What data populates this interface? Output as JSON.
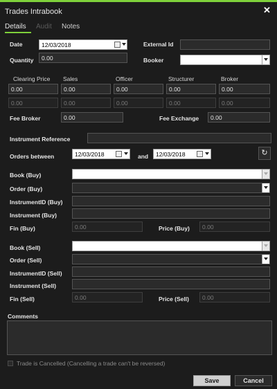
{
  "window": {
    "title": "Trades Intrabook",
    "close_glyph": "✕"
  },
  "tabs": [
    {
      "label": "Details",
      "state": "active"
    },
    {
      "label": "Audit",
      "state": "disabled"
    },
    {
      "label": "Notes",
      "state": "normal"
    }
  ],
  "header_fields": {
    "date_label": "Date",
    "date_value": "12/03/2018",
    "external_id_label": "External Id",
    "external_id_value": "",
    "quantity_label": "Quantity",
    "quantity_value": "0.00",
    "booker_label": "Booker",
    "booker_value": ""
  },
  "fees_grid": {
    "headers": [
      "Clearing Price",
      "Sales",
      "Officer",
      "Structurer",
      "Broker"
    ],
    "row1": [
      "0.00",
      "0.00",
      "0.00",
      "0.00",
      "0.00"
    ],
    "row2": [
      "0.00",
      "0.00",
      "0.00",
      "0.00",
      "0.00"
    ]
  },
  "fee_broker": {
    "label": "Fee Broker",
    "value": "0.00"
  },
  "fee_exchange": {
    "label": "Fee Exchange",
    "value": "0.00"
  },
  "instrument_reference": {
    "label": "Instrument Reference",
    "value": ""
  },
  "orders_between": {
    "label": "Orders between",
    "from": "12/03/2018",
    "and_label": "and",
    "to": "12/03/2018"
  },
  "buy": {
    "book_label": "Book (Buy)",
    "book_value": "",
    "order_label": "Order (Buy)",
    "order_value": "",
    "instrument_id_label": "InstrumentID (Buy)",
    "instrument_id_value": "",
    "instrument_label": "Instrument (Buy)",
    "instrument_value": "",
    "fin_label": "Fin (Buy)",
    "fin_value": "0.00",
    "price_label": "Price (Buy)",
    "price_value": "0.00"
  },
  "sell": {
    "book_label": "Book (Sell)",
    "book_value": "",
    "order_label": "Order (Sell)",
    "order_value": "",
    "instrument_id_label": "InstrumentID (Sell)",
    "instrument_id_value": "",
    "instrument_label": "Instrument (Sell)",
    "instrument_value": "",
    "fin_label": "Fin (Sell)",
    "fin_value": "0.00",
    "price_label": "Price (Sell)",
    "price_value": "0.00"
  },
  "comments": {
    "label": "Comments",
    "value": ""
  },
  "cancelled": {
    "label": "Trade is Cancelled (Cancelling a trade can't be reversed)",
    "checked": false
  },
  "actions": {
    "save_label": "Save",
    "cancel_label": "Cancel"
  },
  "icons": {
    "refresh_glyph": "↻",
    "calendar": "calendar-icon",
    "dropdown": "chevron-down-icon"
  },
  "colors": {
    "accent": "#7fd13b",
    "background": "#1c1c1c",
    "field": "#2b2b2b"
  }
}
